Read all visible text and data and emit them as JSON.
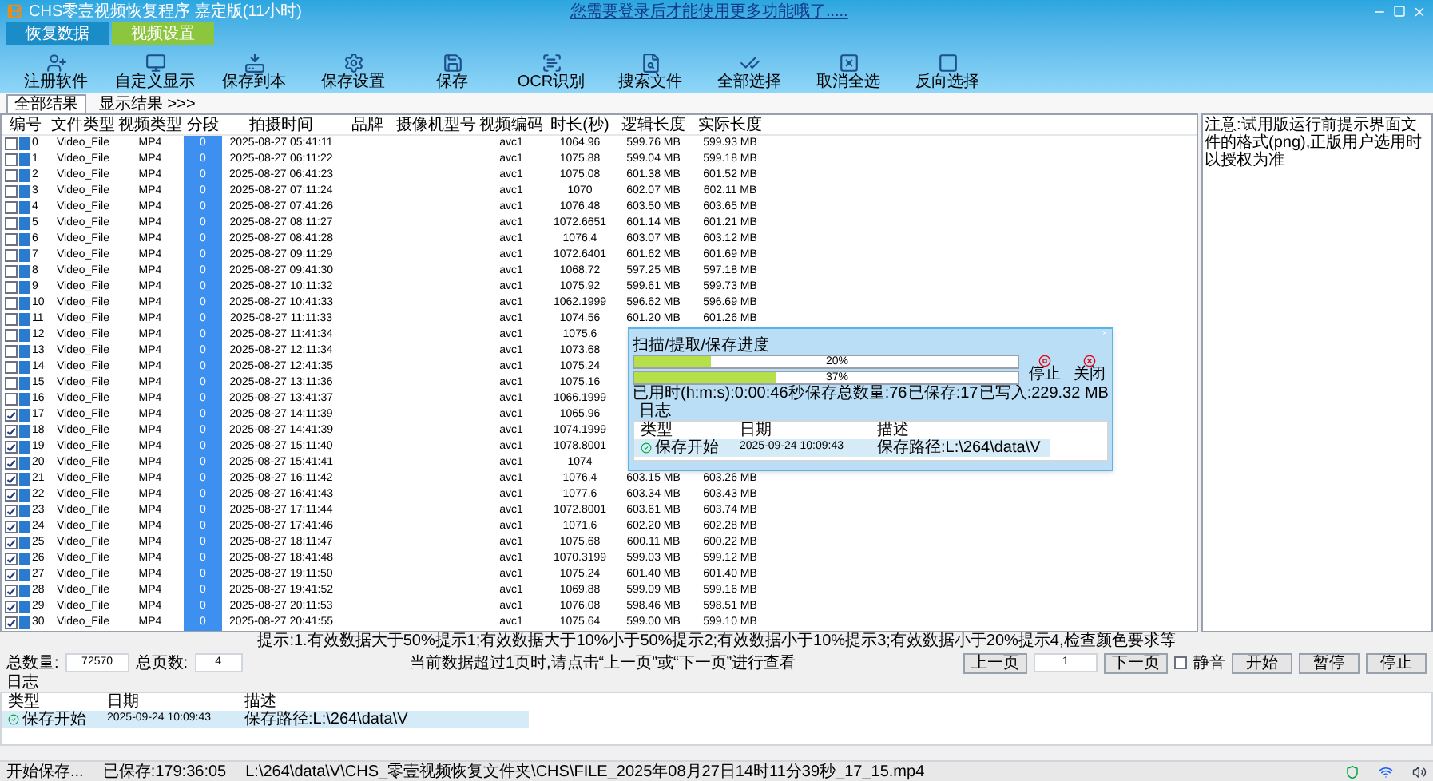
{
  "window": {
    "title": "CHS零壹视频恢复程序 嘉定版(11小时)"
  },
  "top_link": "您需要登录后才能使用更多功能哦了.....",
  "tabs": [
    {
      "label": "恢复数据",
      "selected": false
    },
    {
      "label": "视频设置",
      "selected": true
    }
  ],
  "toolbar": [
    "注册软件",
    "自定义显示",
    "保存到本",
    "保存设置",
    "保存",
    "OCR识别",
    "搜索文件",
    "全部选择",
    "取消全选",
    "反向选择"
  ],
  "subtabs": [
    {
      "label": "全部结果",
      "selected": true
    },
    {
      "label": "显示结果 >>>",
      "selected": false
    }
  ],
  "table": {
    "columns": [
      "编号",
      "文件类型",
      "视频类型",
      "分段",
      "拍摄时间",
      "品牌",
      "摄像机型号",
      "视频编码",
      "时长(秒)",
      "逻辑长度",
      "实际长度"
    ],
    "rows": [
      {
        "checked": false,
        "id": "0",
        "file_type": "Video_File",
        "video_type": "MP4",
        "segment": "0",
        "shot_time": "2025-08-27 05:41:11",
        "codec": "avc1",
        "duration": "1064.96",
        "logical_size": "599.76 MB",
        "actual_size": "599.93 MB"
      },
      {
        "checked": false,
        "id": "1",
        "file_type": "Video_File",
        "video_type": "MP4",
        "segment": "0",
        "shot_time": "2025-08-27 06:11:22",
        "codec": "avc1",
        "duration": "1075.88",
        "logical_size": "599.04 MB",
        "actual_size": "599.18 MB"
      },
      {
        "checked": false,
        "id": "2",
        "file_type": "Video_File",
        "video_type": "MP4",
        "segment": "0",
        "shot_time": "2025-08-27 06:41:23",
        "codec": "avc1",
        "duration": "1075.08",
        "logical_size": "601.38 MB",
        "actual_size": "601.52 MB"
      },
      {
        "checked": false,
        "id": "3",
        "file_type": "Video_File",
        "video_type": "MP4",
        "segment": "0",
        "shot_time": "2025-08-27 07:11:24",
        "codec": "avc1",
        "duration": "1070",
        "logical_size": "602.07 MB",
        "actual_size": "602.11 MB"
      },
      {
        "checked": false,
        "id": "4",
        "file_type": "Video_File",
        "video_type": "MP4",
        "segment": "0",
        "shot_time": "2025-08-27 07:41:26",
        "codec": "avc1",
        "duration": "1076.48",
        "logical_size": "603.50 MB",
        "actual_size": "603.65 MB"
      },
      {
        "checked": false,
        "id": "5",
        "file_type": "Video_File",
        "video_type": "MP4",
        "segment": "0",
        "shot_time": "2025-08-27 08:11:27",
        "codec": "avc1",
        "duration": "1072.6651",
        "logical_size": "601.14 MB",
        "actual_size": "601.21 MB"
      },
      {
        "checked": false,
        "id": "6",
        "file_type": "Video_File",
        "video_type": "MP4",
        "segment": "0",
        "shot_time": "2025-08-27 08:41:28",
        "codec": "avc1",
        "duration": "1076.4",
        "logical_size": "603.07 MB",
        "actual_size": "603.12 MB"
      },
      {
        "checked": false,
        "id": "7",
        "file_type": "Video_File",
        "video_type": "MP4",
        "segment": "0",
        "shot_time": "2025-08-27 09:11:29",
        "codec": "avc1",
        "duration": "1072.6401",
        "logical_size": "601.62 MB",
        "actual_size": "601.69 MB"
      },
      {
        "checked": false,
        "id": "8",
        "file_type": "Video_File",
        "video_type": "MP4",
        "segment": "0",
        "shot_time": "2025-08-27 09:41:30",
        "codec": "avc1",
        "duration": "1068.72",
        "logical_size": "597.25 MB",
        "actual_size": "597.18 MB"
      },
      {
        "checked": false,
        "id": "9",
        "file_type": "Video_File",
        "video_type": "MP4",
        "segment": "0",
        "shot_time": "2025-08-27 10:11:32",
        "codec": "avc1",
        "duration": "1075.92",
        "logical_size": "599.61 MB",
        "actual_size": "599.73 MB"
      },
      {
        "checked": false,
        "id": "10",
        "file_type": "Video_File",
        "video_type": "MP4",
        "segment": "0",
        "shot_time": "2025-08-27 10:41:33",
        "codec": "avc1",
        "duration": "1062.1999",
        "logical_size": "596.62 MB",
        "actual_size": "596.69 MB"
      },
      {
        "checked": false,
        "id": "11",
        "file_type": "Video_File",
        "video_type": "MP4",
        "segment": "0",
        "shot_time": "2025-08-27 11:11:33",
        "codec": "avc1",
        "duration": "1074.56",
        "logical_size": "601.20 MB",
        "actual_size": "601.26 MB"
      },
      {
        "checked": false,
        "id": "12",
        "file_type": "Video_File",
        "video_type": "MP4",
        "segment": "0",
        "shot_time": "2025-08-27 11:41:34",
        "codec": "avc1",
        "duration": "1075.6"
      },
      {
        "checked": false,
        "id": "13",
        "file_type": "Video_File",
        "video_type": "MP4",
        "segment": "0",
        "shot_time": "2025-08-27 12:11:34",
        "codec": "avc1",
        "duration": "1073.68"
      },
      {
        "checked": false,
        "id": "14",
        "file_type": "Video_File",
        "video_type": "MP4",
        "segment": "0",
        "shot_time": "2025-08-27 12:41:35",
        "codec": "avc1",
        "duration": "1075.24"
      },
      {
        "checked": false,
        "id": "15",
        "file_type": "Video_File",
        "video_type": "MP4",
        "segment": "0",
        "shot_time": "2025-08-27 13:11:36",
        "codec": "avc1",
        "duration": "1075.16"
      },
      {
        "checked": false,
        "id": "16",
        "file_type": "Video_File",
        "video_type": "MP4",
        "segment": "0",
        "shot_time": "2025-08-27 13:41:37",
        "codec": "avc1",
        "duration": "1066.1999"
      },
      {
        "checked": true,
        "id": "17",
        "file_type": "Video_File",
        "video_type": "MP4",
        "segment": "0",
        "shot_time": "2025-08-27 14:11:39",
        "codec": "avc1",
        "duration": "1065.96"
      },
      {
        "checked": true,
        "id": "18",
        "file_type": "Video_File",
        "video_type": "MP4",
        "segment": "0",
        "shot_time": "2025-08-27 14:41:39",
        "codec": "avc1",
        "duration": "1074.1999"
      },
      {
        "checked": true,
        "id": "19",
        "file_type": "Video_File",
        "video_type": "MP4",
        "segment": "0",
        "shot_time": "2025-08-27 15:11:40",
        "codec": "avc1",
        "duration": "1078.8001"
      },
      {
        "checked": true,
        "id": "20",
        "file_type": "Video_File",
        "video_type": "MP4",
        "segment": "0",
        "shot_time": "2025-08-27 15:41:41",
        "codec": "avc1",
        "duration": "1074"
      },
      {
        "checked": true,
        "id": "21",
        "file_type": "Video_File",
        "video_type": "MP4",
        "segment": "0",
        "shot_time": "2025-08-27 16:11:42",
        "codec": "avc1",
        "duration": "1076.4",
        "logical_size": "603.15 MB",
        "actual_size": "603.26 MB"
      },
      {
        "checked": true,
        "id": "22",
        "file_type": "Video_File",
        "video_type": "MP4",
        "segment": "0",
        "shot_time": "2025-08-27 16:41:43",
        "codec": "avc1",
        "duration": "1077.6",
        "logical_size": "603.34 MB",
        "actual_size": "603.43 MB"
      },
      {
        "checked": true,
        "id": "23",
        "file_type": "Video_File",
        "video_type": "MP4",
        "segment": "0",
        "shot_time": "2025-08-27 17:11:44",
        "codec": "avc1",
        "duration": "1072.8001",
        "logical_size": "603.61 MB",
        "actual_size": "603.74 MB"
      },
      {
        "checked": true,
        "id": "24",
        "file_type": "Video_File",
        "video_type": "MP4",
        "segment": "0",
        "shot_time": "2025-08-27 17:41:46",
        "codec": "avc1",
        "duration": "1071.6",
        "logical_size": "602.20 MB",
        "actual_size": "602.28 MB"
      },
      {
        "checked": true,
        "id": "25",
        "file_type": "Video_File",
        "video_type": "MP4",
        "segment": "0",
        "shot_time": "2025-08-27 18:11:47",
        "codec": "avc1",
        "duration": "1075.68",
        "logical_size": "600.11 MB",
        "actual_size": "600.22 MB"
      },
      {
        "checked": true,
        "id": "26",
        "file_type": "Video_File",
        "video_type": "MP4",
        "segment": "0",
        "shot_time": "2025-08-27 18:41:48",
        "codec": "avc1",
        "duration": "1070.3199",
        "logical_size": "599.03 MB",
        "actual_size": "599.12 MB"
      },
      {
        "checked": true,
        "id": "27",
        "file_type": "Video_File",
        "video_type": "MP4",
        "segment": "0",
        "shot_time": "2025-08-27 19:11:50",
        "codec": "avc1",
        "duration": "1075.24",
        "logical_size": "601.40 MB",
        "actual_size": "601.40 MB"
      },
      {
        "checked": true,
        "id": "28",
        "file_type": "Video_File",
        "video_type": "MP4",
        "segment": "0",
        "shot_time": "2025-08-27 19:41:52",
        "codec": "avc1",
        "duration": "1069.88",
        "logical_size": "599.09 MB",
        "actual_size": "599.16 MB"
      },
      {
        "checked": true,
        "id": "29",
        "file_type": "Video_File",
        "video_type": "MP4",
        "segment": "0",
        "shot_time": "2025-08-27 20:11:53",
        "codec": "avc1",
        "duration": "1076.08",
        "logical_size": "598.46 MB",
        "actual_size": "598.51 MB"
      },
      {
        "checked": true,
        "id": "30",
        "file_type": "Video_File",
        "video_type": "MP4",
        "segment": "0",
        "shot_time": "2025-08-27 20:41:55",
        "codec": "avc1",
        "duration": "1075.64",
        "logical_size": "599.00 MB",
        "actual_size": "599.10 MB"
      }
    ]
  },
  "progress_dialog": {
    "label": "扫描/提取/保存进度",
    "bars": [
      {
        "level": 0.2,
        "reading": "20%"
      },
      {
        "level": 0.37,
        "reading": "37%"
      }
    ],
    "buttons": [
      "停止",
      "关闭"
    ],
    "stats": [
      "已用时(h:m:s):0:00:46秒",
      "保存总数量:76",
      "已保存:17",
      "已写入:229.32 MB"
    ],
    "log": {
      "title": "日志",
      "columns": [
        "类型",
        "日期",
        "描述"
      ],
      "rows": [
        {
          "type": "保存开始",
          "date": "2025-09-24 10:09:43",
          "description": "保存路径:L:\\264\\data\\V"
        }
      ]
    }
  },
  "right_panel": {
    "notice": "注意:试用版运行前提示界面文件的格式(png),正版用户选用时以授权为准"
  },
  "notice": "提示:1.有效数据大于50%提示1;有效数据大于10%小于50%提示2;有效数据小于10%提示3;有效数据小于20%提示4,检查颜色要求等",
  "pagination": {
    "total_label": "总数量:",
    "total": "72570",
    "pages_label": "总页数:",
    "pages": "4",
    "hint": "当前数据超过1页时,请点击“上一页”或“下一页”进行查看",
    "prev": "上一页",
    "page": "1",
    "next": "下一页",
    "mute": {
      "label": "静音",
      "checked": false
    },
    "buttons": [
      "开始",
      "暂停",
      "停止"
    ]
  },
  "log": {
    "title": "日志",
    "columns": [
      "类型",
      "日期",
      "描述"
    ],
    "rows": [
      {
        "type": "保存开始",
        "date": "2025-09-24 10:09:43",
        "description": "保存路径:L:\\264\\data\\V"
      }
    ]
  },
  "status_bar": {
    "status": "开始保存...",
    "saved": "已保存:179:36:05",
    "path": "L:\\264\\data\\V\\CHS_零壹视频恢复文件夹\\CHS\\FILE_2025年08月27日14时11分39秒_17_15.mp4"
  }
}
